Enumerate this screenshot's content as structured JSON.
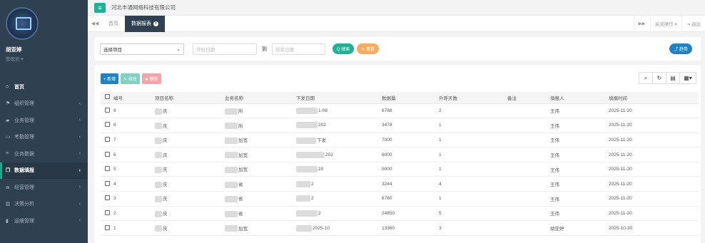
{
  "user": {
    "name": "胡亚婷",
    "role": "管理员 ▾"
  },
  "menu": [
    {
      "icon": "home-icon",
      "glyph": "⌂",
      "label": "首页",
      "arrow": ""
    },
    {
      "icon": "flag-icon",
      "glyph": "⚑",
      "label": "组织管理",
      "arrow": "‹"
    },
    {
      "icon": "briefcase-icon",
      "glyph": "▰",
      "label": "业务管理",
      "arrow": "‹"
    },
    {
      "icon": "monitor-icon",
      "glyph": "▭",
      "label": "考勤管理",
      "arrow": "‹"
    },
    {
      "icon": "list-icon",
      "glyph": "≡",
      "label": "业务数据",
      "arrow": "‹"
    },
    {
      "icon": "copy-icon",
      "glyph": "❐",
      "label": "数据填报",
      "arrow": "‹"
    },
    {
      "icon": "list-icon",
      "glyph": "≣",
      "label": "经营管理",
      "arrow": "‹"
    },
    {
      "icon": "chart-icon",
      "glyph": "▥",
      "label": "决策分析",
      "arrow": "‹"
    },
    {
      "icon": "book-icon",
      "glyph": "▮",
      "label": "运维管理",
      "arrow": "‹"
    }
  ],
  "header": {
    "company": "河北丰通网络科技有限公司"
  },
  "tabs": {
    "home": "首页",
    "active": "数据报表"
  },
  "tab_actions": {
    "close_ops": "关闭操作 ▾",
    "logout": "⇥ 退出"
  },
  "search": {
    "select_value": "选择项目",
    "start_placeholder": "开始日期",
    "to": "到",
    "end_placeholder": "结束日期",
    "search_label": "Q 搜索",
    "reset_label": "↻ 重置",
    "trend_label": "⤴ 趋势"
  },
  "toolbar": {
    "add": "+ 新增",
    "edit": "✎ 修改",
    "delete": "✖ 删除"
  },
  "table": {
    "headers": [
      "编号",
      "项目名称",
      "业务名称",
      "下发日期",
      "数据量",
      "外呼天数",
      "备注",
      "填报人",
      "填报时间"
    ],
    "rows": [
      {
        "id": "9",
        "project": "庆",
        "business": "所",
        "date": "1-08",
        "volume": "6788",
        "days": "2",
        "note": "",
        "reporter": "王伟",
        "time": "2025-11-20"
      },
      {
        "id": "8",
        "project": "庆",
        "business": "所",
        "date": "202",
        "volume": "3478",
        "days": "1",
        "note": "",
        "reporter": "王伟",
        "time": "2025-11-20"
      },
      {
        "id": "7",
        "project": "庆",
        "business": "加宽",
        "date": "下发",
        "volume": "7000",
        "days": "1",
        "note": "",
        "reporter": "王伟",
        "time": "2025-11-20"
      },
      {
        "id": "6",
        "project": "庆",
        "business": "加宽",
        "date": "202",
        "volume": "6000",
        "days": "1",
        "note": "",
        "reporter": "王伟",
        "time": "2025-11-20"
      },
      {
        "id": "5",
        "project": "庆",
        "business": "加宽",
        "date": "20",
        "volume": "5000",
        "days": "1",
        "note": "",
        "reporter": "王伟",
        "time": "2025-11-20"
      },
      {
        "id": "4",
        "project": "庆",
        "business": "省",
        "date": "2",
        "volume": "3244",
        "days": "4",
        "note": "",
        "reporter": "王伟",
        "time": "2025-11-20"
      },
      {
        "id": "3",
        "project": "庆",
        "business": "省",
        "date": "2",
        "volume": "6780",
        "days": "1",
        "note": "",
        "reporter": "王伟",
        "time": "2025-11-20"
      },
      {
        "id": "2",
        "project": "庆",
        "business": "省",
        "date": "2",
        "volume": "24850",
        "days": "5",
        "note": "",
        "reporter": "王伟",
        "time": "2025-11-20"
      },
      {
        "id": "1",
        "project": "庆",
        "business": "加宽",
        "date": "2025-10",
        "volume": "13360",
        "days": "3",
        "note": "",
        "reporter": "胡亚婷",
        "time": "2025-10-30"
      }
    ]
  },
  "colors": {
    "sidebar": "#2f4050",
    "accent_green": "#1ab394",
    "accent_blue": "#1c84c6",
    "accent_orange": "#f8ac59"
  }
}
